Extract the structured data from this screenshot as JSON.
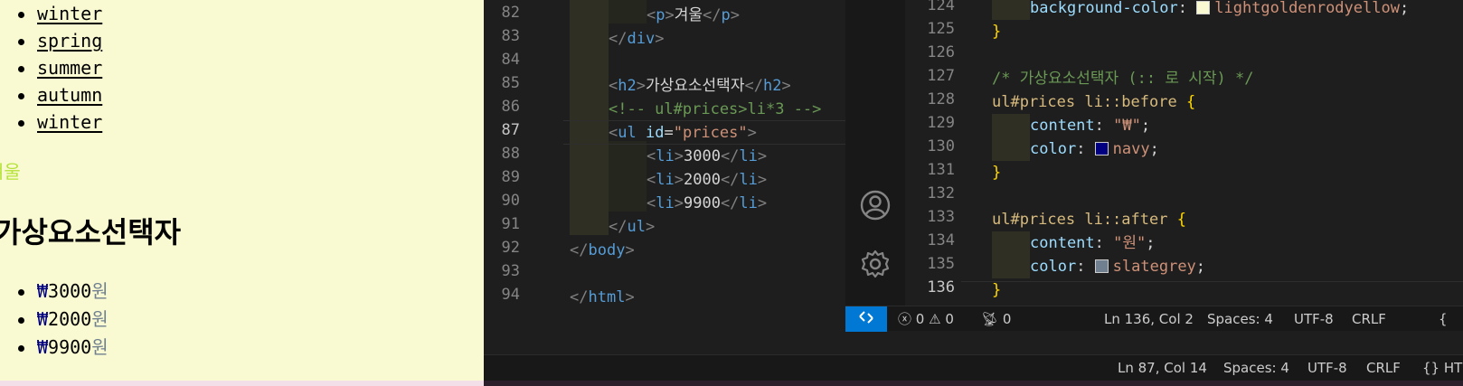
{
  "preview": {
    "seasons": [
      "winter",
      "spring",
      "summer",
      "autumn",
      "winter"
    ],
    "paragraph": "겨울",
    "heading": "가상요소선택자",
    "prices": [
      {
        "currency": "₩",
        "amount": "3000",
        "suffix": "원"
      },
      {
        "currency": "₩",
        "amount": "2000",
        "suffix": "원"
      },
      {
        "currency": "₩",
        "amount": "9900",
        "suffix": "원"
      }
    ]
  },
  "html_editor": {
    "line_numbers": [
      "82",
      "83",
      "84",
      "85",
      "86",
      "87",
      "88",
      "89",
      "90",
      "91",
      "92",
      "93",
      "94"
    ],
    "active_line": "87",
    "code": {
      "l82_tag": "p",
      "l82_text": "겨울",
      "l83_tag": "div",
      "l85_tag": "h2",
      "l85_text": "가상요소선택자",
      "l86_comment": "<!-- ul#prices>li*3 -->",
      "l87_tag": "ul",
      "l87_attr": "id",
      "l87_value": "\"prices\"",
      "l88_text": "3000",
      "l89_text": "2000",
      "l90_text": "9900",
      "li_tag": "li",
      "l92_tag": "body",
      "l94_tag": "html"
    },
    "status": {
      "position": "Ln 87, Col 14",
      "spaces": "Spaces: 4",
      "encoding": "UTF-8",
      "eol": "CRLF",
      "language": "HTM"
    }
  },
  "css_editor": {
    "line_numbers": [
      "124",
      "125",
      "126",
      "127",
      "128",
      "129",
      "130",
      "131",
      "132",
      "133",
      "134",
      "135",
      "136"
    ],
    "active_line": "136",
    "code": {
      "l124_prop": "background-color",
      "l124_value": "lightgoldenrodyellow",
      "l127_comment": "/* 가상요소선택자 (:: 로 시작) */",
      "l128_selector": "ul#prices li::before",
      "l129_prop": "content",
      "l129_value": "\"₩\"",
      "l130_prop": "color",
      "l130_value": "navy",
      "l133_selector": "ul#prices li::after",
      "l134_prop": "content",
      "l134_value": "\"원\"",
      "l135_prop": "color",
      "l135_value": "slategrey",
      "open_brace": "{",
      "close_brace": "}"
    },
    "swatches": {
      "lightgoldenrodyellow": "#fafad2",
      "navy": "#000080",
      "slategrey": "#708090"
    },
    "status": {
      "errors": "0",
      "warnings": "0",
      "ports": "0",
      "position": "Ln 136, Col 2",
      "spaces": "Spaces: 4",
      "encoding": "UTF-8",
      "eol": "CRLF",
      "language": "{"
    }
  },
  "icons": [
    "account-icon",
    "gear-icon",
    "remote-icon",
    "error-icon",
    "warning-icon",
    "broadcast-icon",
    "braces-icon"
  ]
}
